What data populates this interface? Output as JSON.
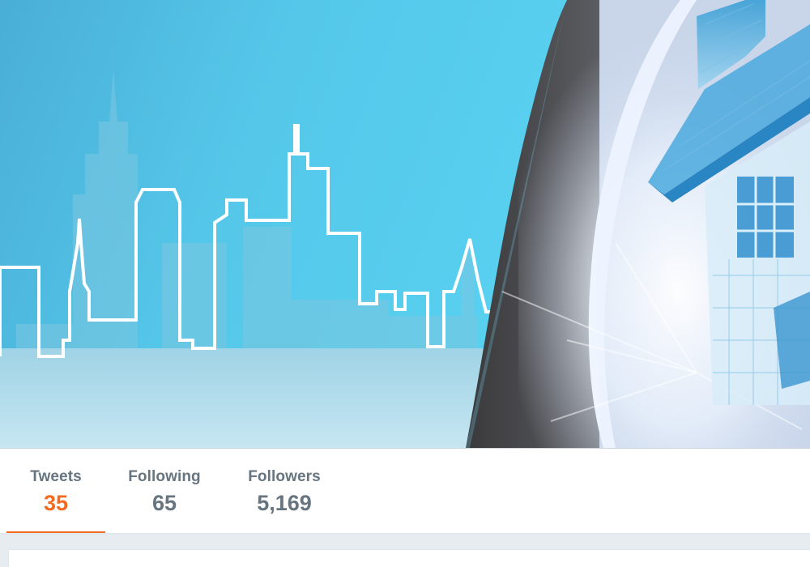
{
  "profile_nav": {
    "stats": [
      {
        "label": "Tweets",
        "value": "35",
        "active": true
      },
      {
        "label": "Following",
        "value": "65",
        "active": false
      },
      {
        "label": "Followers",
        "value": "5,169",
        "active": false
      }
    ]
  },
  "colors": {
    "accent": "#f26b21",
    "stat_text": "#66757f",
    "banner_sky": "#4fc3e3",
    "banner_sky_light": "#a9d9ea"
  },
  "banner": {
    "description_icons": [
      "city-skyline-outline-icon",
      "house-blueprint-icon"
    ]
  }
}
